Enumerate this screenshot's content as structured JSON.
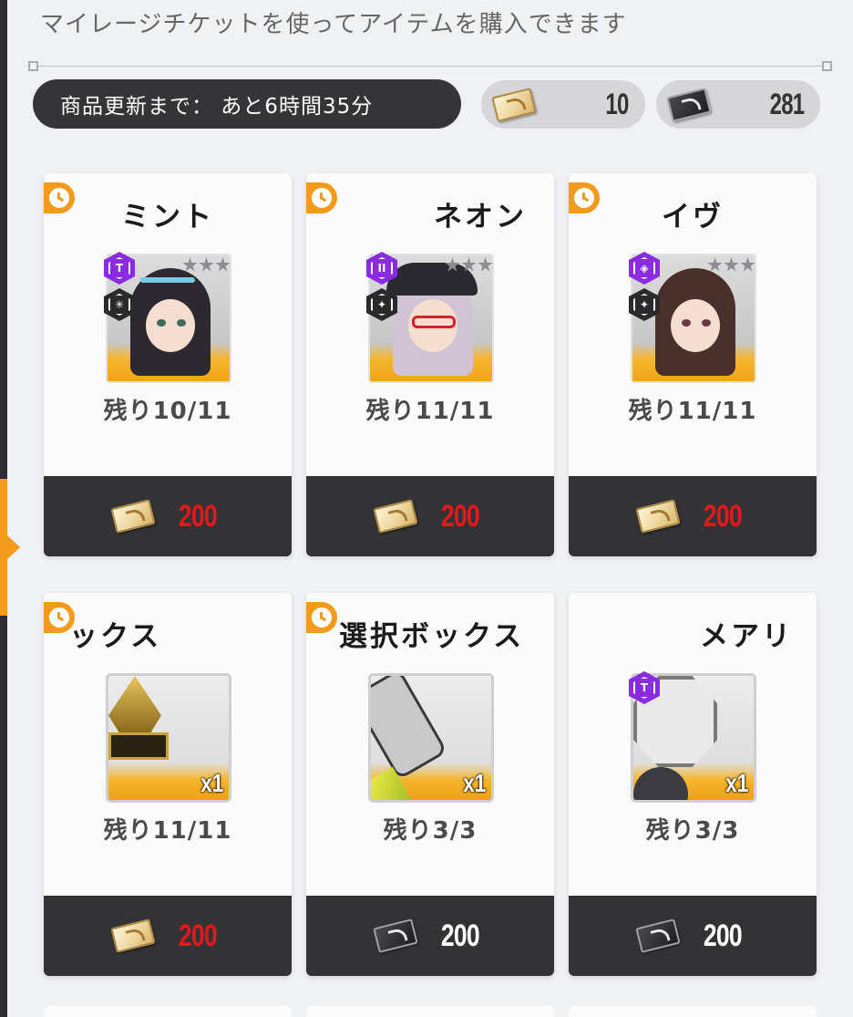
{
  "header": {
    "subtitle": "マイレージチケットを使ってアイテムを購入できます",
    "timer_label": "商品更新まで： あと6時間35分"
  },
  "currencies": [
    {
      "icon": "gold-mileage-ticket-icon",
      "value": "10"
    },
    {
      "icon": "black-mileage-ticket-icon",
      "value": "281"
    }
  ],
  "colors": {
    "accent": "#f39a1d",
    "price_red": "#e0191c",
    "rarity_purple": "#8a2be2",
    "dark_bar": "#333336"
  },
  "shop": {
    "items": [
      {
        "name": "ミント",
        "remaining": "残り10/11",
        "price": "200",
        "currency": "gold"
      },
      {
        "name": "ネオン",
        "remaining": "残り11/11",
        "price": "200",
        "currency": "gold"
      },
      {
        "name": "イヴ",
        "remaining": "残り11/11",
        "price": "200",
        "currency": "gold"
      },
      {
        "name": "ックス",
        "remaining": "残り11/11",
        "price": "200",
        "currency": "gold",
        "quantity": "x1"
      },
      {
        "name": "選択ボックス",
        "remaining": "残り3/3",
        "price": "200",
        "currency": "black",
        "quantity": "x1"
      },
      {
        "name": "メアリ",
        "remaining": "残り3/3",
        "price": "200",
        "currency": "black",
        "quantity": "x1"
      }
    ]
  }
}
